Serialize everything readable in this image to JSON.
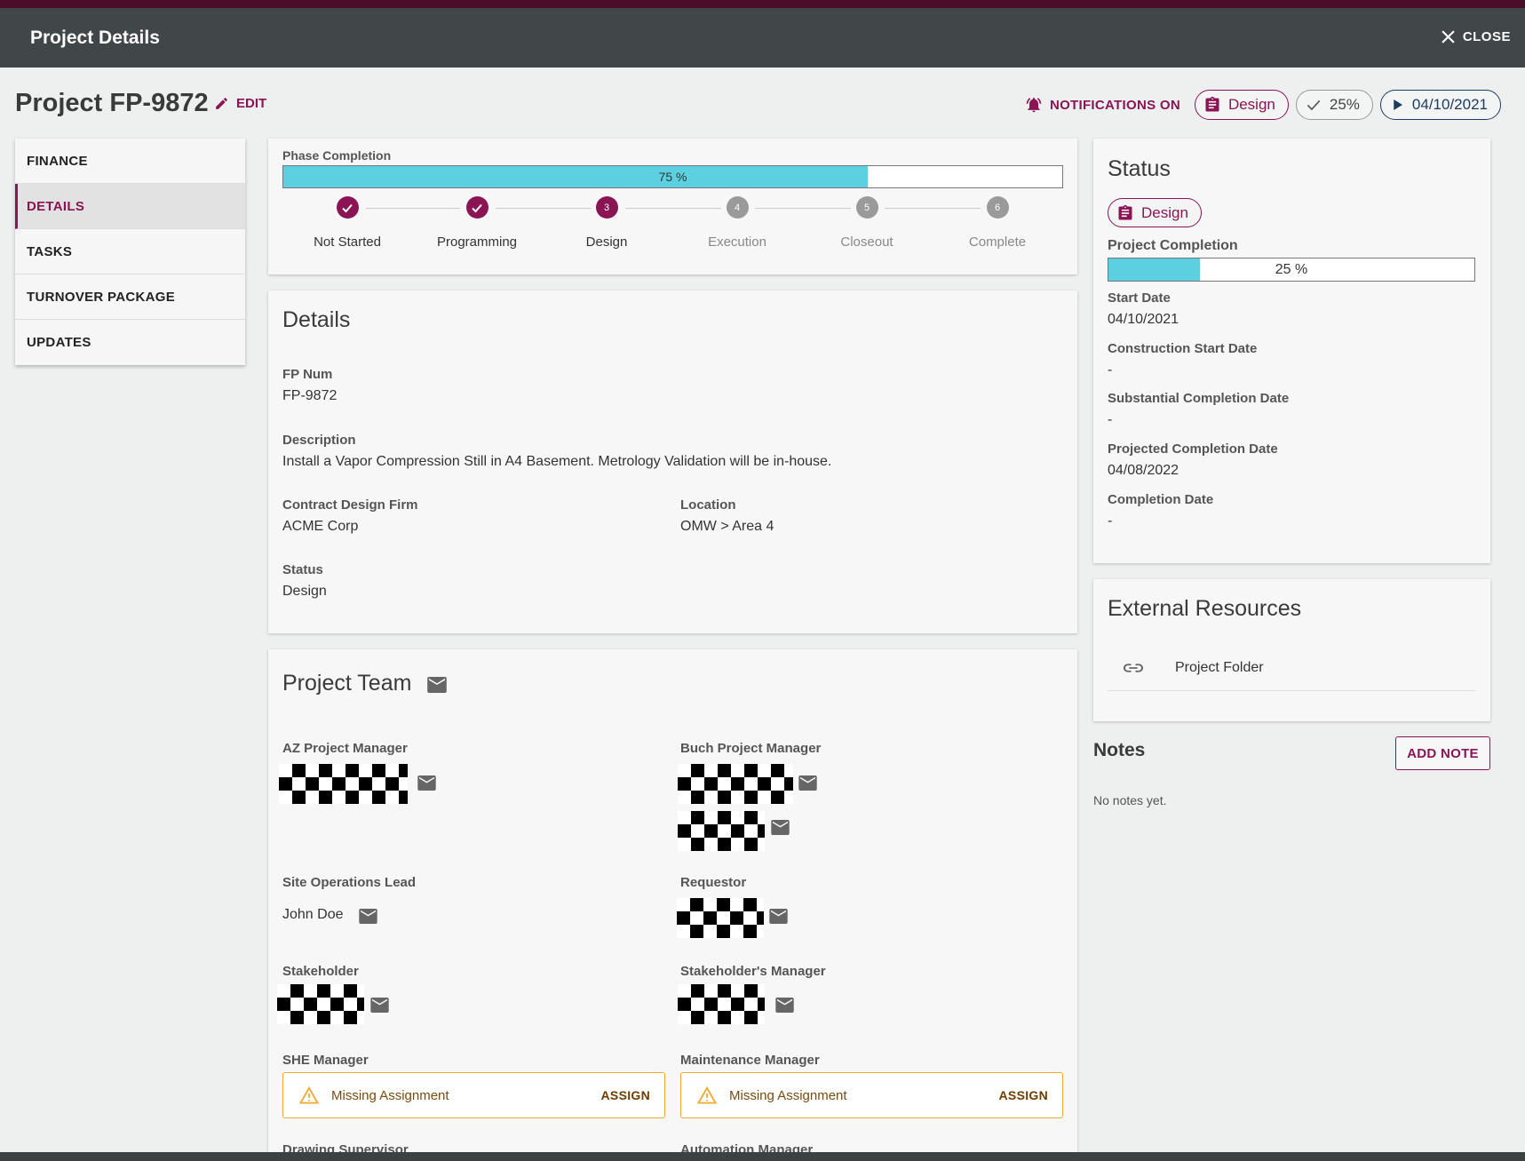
{
  "app": {
    "title": "Project Details",
    "close_label": "CLOSE"
  },
  "header": {
    "project_title": "Project FP-9872",
    "edit_label": "EDIT",
    "notifications_label": "NOTIFICATIONS ON",
    "status_chip": "Design",
    "completion_chip": "25%",
    "date_chip": "04/10/2021"
  },
  "sidebar": {
    "items": [
      {
        "label": "FINANCE"
      },
      {
        "label": "DETAILS"
      },
      {
        "label": "TASKS"
      },
      {
        "label": "TURNOVER PACKAGE"
      },
      {
        "label": "UPDATES"
      }
    ],
    "active": "DETAILS"
  },
  "phase": {
    "label": "Phase Completion",
    "percent": 75,
    "percent_text": "75 %",
    "steps": [
      {
        "label": "Not Started",
        "number": "1",
        "state": "done"
      },
      {
        "label": "Programming",
        "number": "2",
        "state": "done"
      },
      {
        "label": "Design",
        "number": "3",
        "state": "current"
      },
      {
        "label": "Execution",
        "number": "4",
        "state": "pending"
      },
      {
        "label": "Closeout",
        "number": "5",
        "state": "pending"
      },
      {
        "label": "Complete",
        "number": "6",
        "state": "pending"
      }
    ]
  },
  "details": {
    "title": "Details",
    "fp_num_label": "FP Num",
    "fp_num": "FP-9872",
    "description_label": "Description",
    "description": "Install a Vapor Compression Still in A4 Basement. Metrology Validation will be in-house.",
    "design_firm_label": "Contract Design Firm",
    "design_firm": "ACME Corp",
    "location_label": "Location",
    "location": "OMW > Area 4",
    "status_label": "Status",
    "status": "Design"
  },
  "team": {
    "title": "Project Team",
    "az_pm_label": "AZ Project Manager",
    "buch_pm_label": "Buch Project Manager",
    "site_ops_label": "Site Operations Lead",
    "site_ops_name": "John Doe",
    "requestor_label": "Requestor",
    "stakeholder_label": "Stakeholder",
    "stakeholder_mgr_label": "Stakeholder's Manager",
    "she_mgr_label": "SHE Manager",
    "maint_mgr_label": "Maintenance Manager",
    "missing_text": "Missing Assignment",
    "assign_label": "ASSIGN",
    "drawing_sup_label": "Drawing Supervisor",
    "automation_mgr_label": "Automation Manager"
  },
  "status_panel": {
    "title": "Status",
    "chip": "Design",
    "completion_label": "Project Completion",
    "completion_percent": 25,
    "completion_text": "25 %",
    "start_date_label": "Start Date",
    "start_date": "04/10/2021",
    "construction_start_label": "Construction Start Date",
    "construction_start": "-",
    "substantial_label": "Substantial Completion Date",
    "substantial": "-",
    "projected_label": "Projected Completion Date",
    "projected": "04/08/2022",
    "completion_date_label": "Completion Date",
    "completion_date": "-"
  },
  "external": {
    "title": "External Resources",
    "link_label": "Project Folder"
  },
  "notes": {
    "title": "Notes",
    "add_label": "ADD NOTE",
    "empty_text": "No notes yet."
  },
  "colors": {
    "accent": "#8a1454",
    "progress": "#5cd0e0",
    "appbar": "#414748",
    "warning": "#f0a830"
  }
}
